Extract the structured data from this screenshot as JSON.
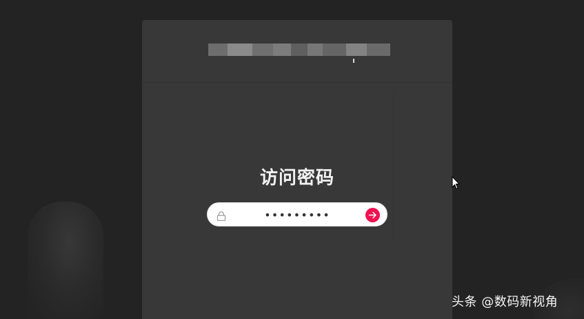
{
  "dialog": {
    "title": "访问密码"
  },
  "password_field": {
    "value": "•••••••••",
    "lock_icon": "lock-icon",
    "submit_icon": "arrow-right-icon"
  },
  "watermark": {
    "text": "头条 @数码新视角"
  },
  "colors": {
    "background": "#232323",
    "panel": "#383838",
    "accent": "#f0114f",
    "heading": "#f2f2f2"
  }
}
